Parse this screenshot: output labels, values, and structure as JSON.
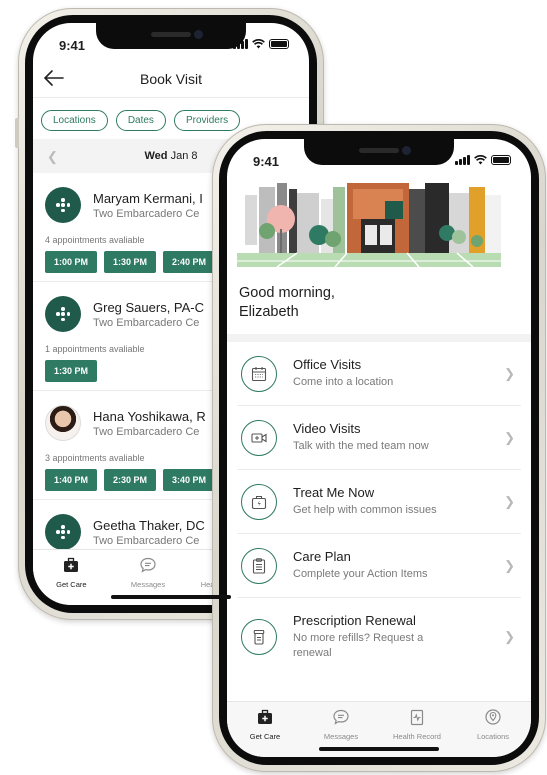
{
  "phone1": {
    "status": {
      "time": "9:41"
    },
    "header": {
      "title": "Book Visit"
    },
    "filters": [
      "Locations",
      "Dates",
      "Providers"
    ],
    "date_bar": {
      "weekday": "Wed",
      "date": "Jan 8"
    },
    "providers": [
      {
        "name": "Maryam Kermani, I",
        "location": "Two Embarcadero Ce",
        "availability": "4 appointments avaliable",
        "slots": [
          "1:00 PM",
          "1:30 PM",
          "2:40 PM"
        ],
        "avatar": "logo"
      },
      {
        "name": "Greg Sauers, PA-C",
        "location": "Two Embarcadero Ce",
        "availability": "1 appointments avaliable",
        "slots": [
          "1:30 PM"
        ],
        "avatar": "logo"
      },
      {
        "name": "Hana Yoshikawa, R",
        "location": "Two Embarcadero Ce",
        "availability": "3 appointments avaliable",
        "slots": [
          "1:40 PM",
          "2:30 PM",
          "3:40 PM"
        ],
        "avatar": "photo"
      },
      {
        "name": "Geetha Thaker, DC",
        "location": "Two Embarcadero Ce",
        "availability": "",
        "slots": [],
        "avatar": "logo"
      }
    ],
    "tabs": [
      "Get Care",
      "Messages",
      "Health Record"
    ]
  },
  "phone2": {
    "status": {
      "time": "9:41"
    },
    "greeting": {
      "line1": "Good morning,",
      "line2": "Elizabeth"
    },
    "menu": [
      {
        "title": "Office Visits",
        "subtitle": "Come into a location",
        "icon": "calendar-icon"
      },
      {
        "title": "Video Visits",
        "subtitle": "Talk with the med team now",
        "icon": "video-icon"
      },
      {
        "title": "Treat Me Now",
        "subtitle": "Get help with common issues",
        "icon": "medkit-icon"
      },
      {
        "title": "Care Plan",
        "subtitle": "Complete your Action Items",
        "icon": "clipboard-icon"
      },
      {
        "title": "Prescription Renewal",
        "subtitle": "No more refills? Request a renewal",
        "icon": "pill-bottle-icon"
      }
    ],
    "tabs": [
      "Get Care",
      "Messages",
      "Health Record",
      "Locations"
    ]
  },
  "colors": {
    "brand_green": "#2f7a63",
    "dark_green": "#1f5a4b"
  }
}
